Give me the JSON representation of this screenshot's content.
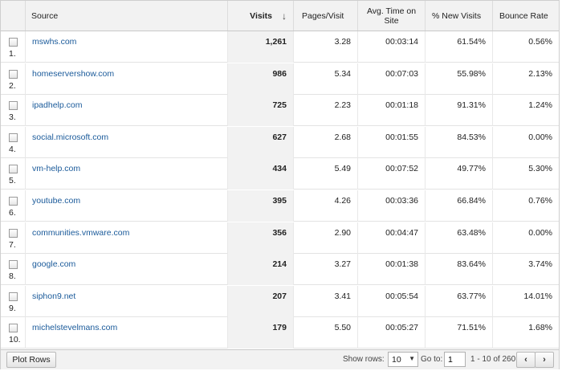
{
  "table": {
    "columns": {
      "source": "Source",
      "visits": "Visits",
      "pages_visit": "Pages/Visit",
      "avg_time_line1": "Avg. Time on",
      "avg_time_line2": "Site",
      "new_visits": "% New Visits",
      "bounce_rate": "Bounce Rate"
    },
    "sort_indicator": "arrow-down-icon",
    "rows": [
      {
        "index": "1.",
        "source": "mswhs.com",
        "visits": "1,261",
        "pages_visit": "3.28",
        "avg_time": "00:03:14",
        "new_visits": "61.54%",
        "bounce_rate": "0.56%"
      },
      {
        "index": "2.",
        "source": "homeservershow.com",
        "visits": "986",
        "pages_visit": "5.34",
        "avg_time": "00:07:03",
        "new_visits": "55.98%",
        "bounce_rate": "2.13%"
      },
      {
        "index": "3.",
        "source": "ipadhelp.com",
        "visits": "725",
        "pages_visit": "2.23",
        "avg_time": "00:01:18",
        "new_visits": "91.31%",
        "bounce_rate": "1.24%"
      },
      {
        "index": "4.",
        "source": "social.microsoft.com",
        "visits": "627",
        "pages_visit": "2.68",
        "avg_time": "00:01:55",
        "new_visits": "84.53%",
        "bounce_rate": "0.00%"
      },
      {
        "index": "5.",
        "source": "vm-help.com",
        "visits": "434",
        "pages_visit": "5.49",
        "avg_time": "00:07:52",
        "new_visits": "49.77%",
        "bounce_rate": "5.30%"
      },
      {
        "index": "6.",
        "source": "youtube.com",
        "visits": "395",
        "pages_visit": "4.26",
        "avg_time": "00:03:36",
        "new_visits": "66.84%",
        "bounce_rate": "0.76%"
      },
      {
        "index": "7.",
        "source": "communities.vmware.com",
        "visits": "356",
        "pages_visit": "2.90",
        "avg_time": "00:04:47",
        "new_visits": "63.48%",
        "bounce_rate": "0.00%"
      },
      {
        "index": "8.",
        "source": "google.com",
        "visits": "214",
        "pages_visit": "3.27",
        "avg_time": "00:01:38",
        "new_visits": "83.64%",
        "bounce_rate": "3.74%"
      },
      {
        "index": "9.",
        "source": "siphon9.net",
        "visits": "207",
        "pages_visit": "3.41",
        "avg_time": "00:05:54",
        "new_visits": "63.77%",
        "bounce_rate": "14.01%"
      },
      {
        "index": "10.",
        "source": "michelstevelmans.com",
        "visits": "179",
        "pages_visit": "5.50",
        "avg_time": "00:05:27",
        "new_visits": "71.51%",
        "bounce_rate": "1.68%"
      }
    ]
  },
  "footer": {
    "plot_rows_label": "Plot Rows",
    "show_rows_label": "Show rows:",
    "show_rows_value": "10",
    "goto_label": "Go to:",
    "goto_value": "1",
    "range_text": "1 - 10 of 260",
    "prev_icon": "chevron-left-icon",
    "next_icon": "chevron-right-icon"
  },
  "colors": {
    "link": "#1a5a9a",
    "header_bg": "#f2f2f2",
    "sorted_column_bg": "#f2f2f2"
  }
}
